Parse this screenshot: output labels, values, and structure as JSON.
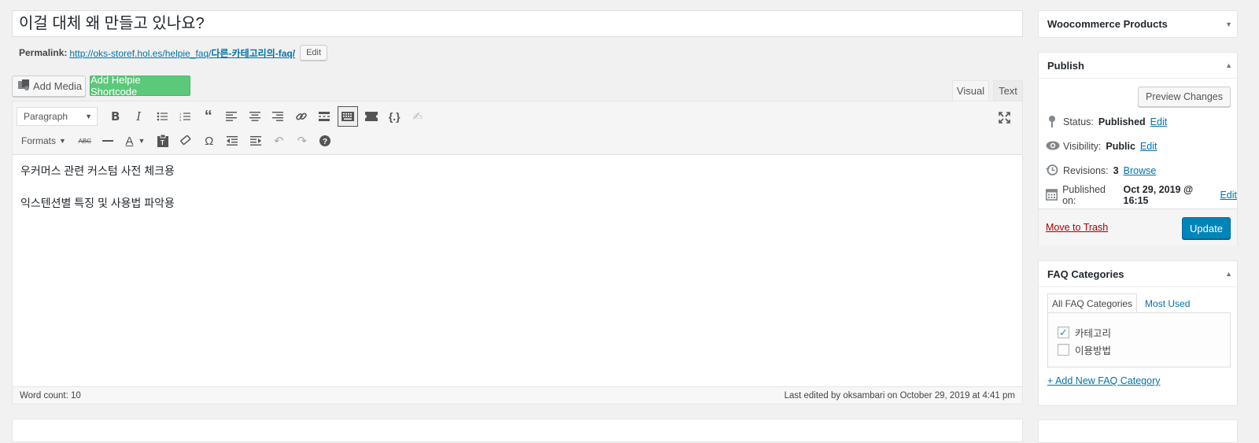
{
  "post": {
    "title": "이걸 대체 왜 만들고 있나요?",
    "permalink_label": "Permalink:",
    "permalink_base": "http://oks-storef.hol.es/helpie_faq/",
    "permalink_slug": "다른-카테고리의-faq/",
    "edit_label": "Edit"
  },
  "media": {
    "add_media_label": "Add Media",
    "add_helpie_label": "Add Helpie Shortcode"
  },
  "editor": {
    "tab_visual": "Visual",
    "tab_text": "Text",
    "format_value": "Paragraph",
    "formats_label": "Formats",
    "content": [
      "우커머스 관련 커스텀 사전 체크용",
      "익스텐션별 특징 및 사용법 파악용"
    ],
    "word_count": "Word count: 10",
    "last_edited": "Last edited by oksambari on October 29, 2019 at 4:41 pm"
  },
  "sidebar": {
    "woo_title": "Woocommerce Products",
    "publish": {
      "title": "Publish",
      "preview_label": "Preview Changes",
      "status_label": "Status:",
      "status_value": "Published",
      "status_edit": "Edit",
      "visibility_label": "Visibility:",
      "visibility_value": "Public",
      "visibility_edit": "Edit",
      "revisions_label": "Revisions:",
      "revisions_value": "3",
      "revisions_browse": "Browse",
      "published_label": "Published on:",
      "published_value": "Oct 29, 2019 @ 16:15",
      "published_edit": "Edit",
      "trash_label": "Move to Trash",
      "update_label": "Update"
    },
    "faq": {
      "title": "FAQ Categories",
      "tab_all": "All FAQ Categories",
      "tab_most_used": "Most Used",
      "categories": [
        {
          "label": "카테고리",
          "checked": true
        },
        {
          "label": "이용방법",
          "checked": false
        }
      ],
      "add_new_label": "+ Add New FAQ Category"
    }
  },
  "colors": {
    "accent": "#0073aa",
    "update_button": "#0085ba",
    "helpie_button": "#5cc87a",
    "trash": "#a00000"
  }
}
